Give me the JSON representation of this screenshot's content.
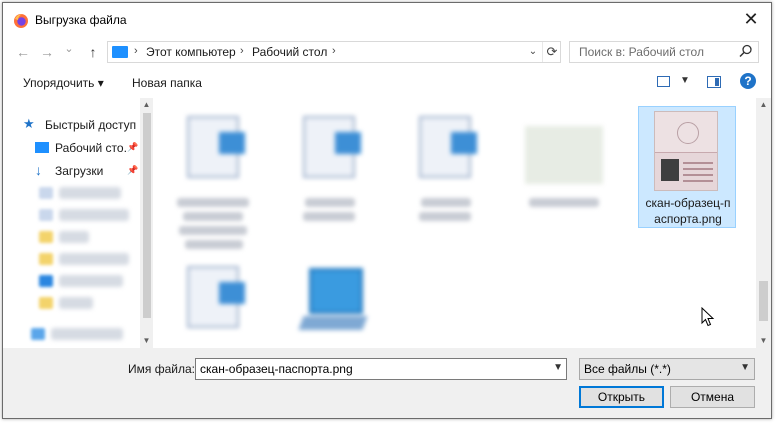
{
  "window": {
    "title": "Выгрузка файла",
    "close_symbol": "✕"
  },
  "navigation": {
    "back_symbol": "←",
    "forward_symbol": "→",
    "recent_symbol": "⌄",
    "up_symbol": "↑",
    "breadcrumb": [
      "Этот компьютер",
      "Рабочий стол"
    ],
    "separator": "›",
    "refresh_symbol": "⟳",
    "dropdown_symbol": "⌄",
    "search_placeholder": "Поиск в: Рабочий стол"
  },
  "toolbar": {
    "organize_label": "Упорядочить ▾",
    "new_folder_label": "Новая папка",
    "help_symbol": "?"
  },
  "sidebar": {
    "items": [
      {
        "label": "Быстрый доступ",
        "icon": "star-icon"
      },
      {
        "label": "Рабочий сто.",
        "icon": "desktop-icon",
        "pinned": true
      },
      {
        "label": "Загрузки",
        "icon": "download-icon",
        "pinned": true
      }
    ]
  },
  "files": {
    "selected": {
      "name": "скан-образец-паспорта.png",
      "label_line1": "скан-образец-п",
      "label_line2": "аспорта.png"
    }
  },
  "bottom": {
    "filename_label": "Имя файла:",
    "filename_value": "скан-образец-паспорта.png",
    "filter_value": "Все файлы (*.*)",
    "open_label": "Открыть",
    "cancel_label": "Отмена"
  },
  "colors": {
    "accent": "#0078d7",
    "selection": "#cce8ff"
  }
}
